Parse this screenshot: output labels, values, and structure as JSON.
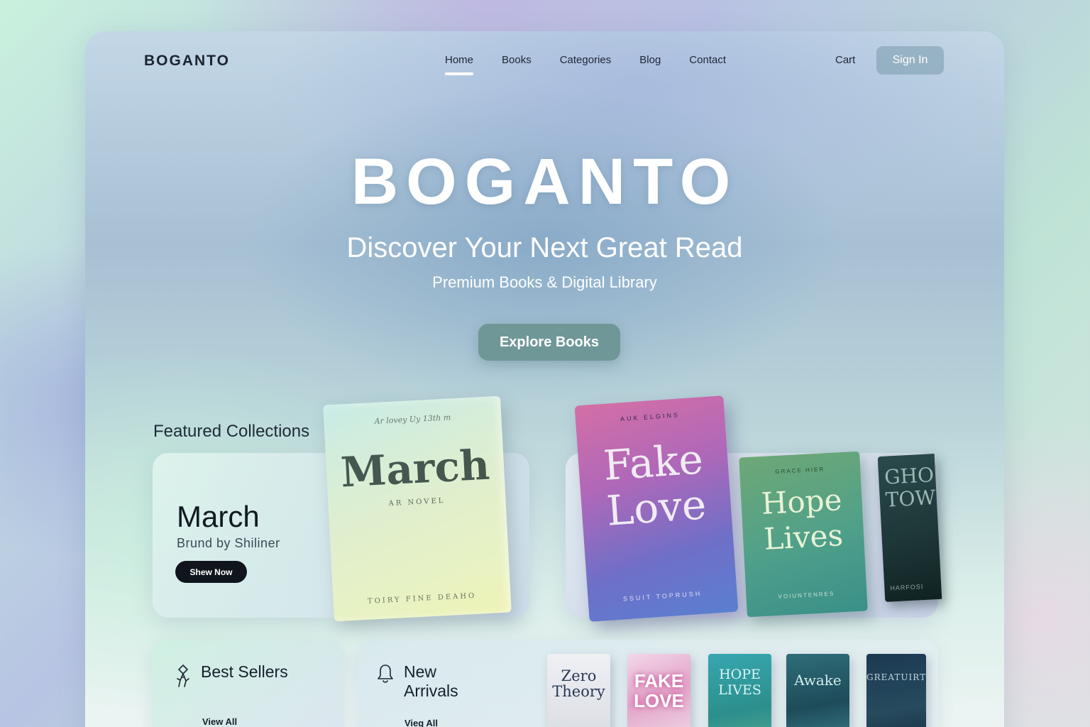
{
  "brand": {
    "logo": "BOGANTO"
  },
  "nav": {
    "items": [
      {
        "label": "Home",
        "active": true
      },
      {
        "label": "Books",
        "active": false
      },
      {
        "label": "Categories",
        "active": false
      },
      {
        "label": "Blog",
        "active": false
      },
      {
        "label": "Contact",
        "active": false
      }
    ],
    "cart_label": "Cart",
    "signin_label": "Sign In"
  },
  "hero": {
    "title": "BOGANTO",
    "subtitle": "Discover Your Next Great Read",
    "tagline": "Premium Books & Digital Library",
    "cta_label": "Explore Books"
  },
  "featured": {
    "section_title": "Featured Collections",
    "main": {
      "title": "March",
      "author": "Brund by Shiliner",
      "button_label": "Shew Now"
    },
    "book_covers": [
      {
        "title": "March",
        "script": "Ar lovey Uy 13th  m",
        "subtitle": "AR NOVEL",
        "footer": "TOIRY FINE DEAHO"
      },
      {
        "title_line1": "Fake",
        "title_line2": "Love",
        "top": "AUK ELGINS",
        "footer": "SSUIT TOPRUSH"
      },
      {
        "title_line1": "Hope",
        "title_line2": "Lives",
        "top": "GRACE HIER",
        "footer": "VOIUNTENRES"
      },
      {
        "title_line1": "GHOS",
        "title_line2": "TOWN",
        "footer": "HARFOSI"
      }
    ]
  },
  "best_sellers": {
    "title": "Best Sellers",
    "view_all": "View All",
    "icon": "award-icon"
  },
  "new_arrivals": {
    "title_line1": "New",
    "title_line2": "Arrivals",
    "view_all": "Vieg All",
    "icon": "bell-icon",
    "books": [
      {
        "line1": "Zero",
        "line2": "Theory"
      },
      {
        "line1": "FAKE",
        "line2": "LOVE"
      },
      {
        "line1": "HOPE",
        "line2": "LIVES"
      },
      {
        "line1": "Awake",
        "line2": ""
      },
      {
        "line1": "GREATUIRT",
        "line2": ""
      }
    ]
  },
  "colors": {
    "accent": "#6f9797",
    "signin_bg": "#89a9b3",
    "dark_button": "#0f141d",
    "text_dark": "#16202b"
  }
}
